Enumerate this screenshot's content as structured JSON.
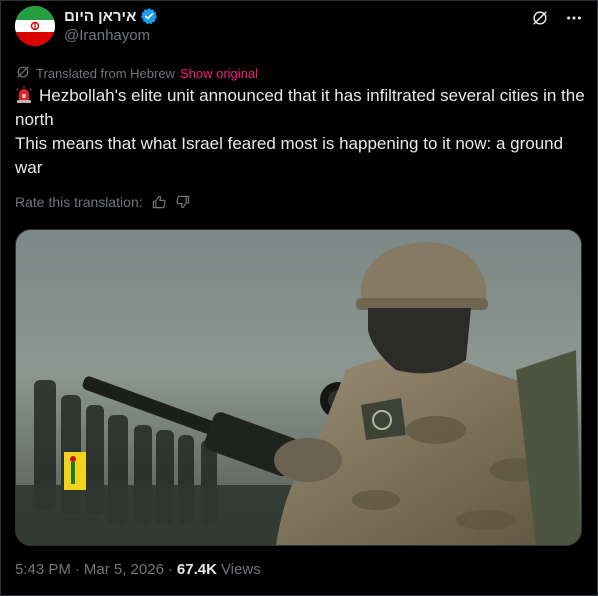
{
  "author": {
    "display_name": "איראן היום",
    "handle": "@Iranhayom"
  },
  "translation": {
    "note": "Translated from Hebrew",
    "show_original": "Show original",
    "rate_label": "Rate this translation:"
  },
  "tweet": {
    "line1": "Hezbollah's elite unit announced that it has infiltrated several cities in the north",
    "line2": "This means that what Israel feared most is happening to it now: a ground war"
  },
  "meta": {
    "time": "5:43 PM",
    "separator": "·",
    "date": "Mar 5, 2026",
    "views_count": "67.4K",
    "views_label": "Views"
  },
  "colors": {
    "background": "#000000",
    "text": "#e7e9ea",
    "muted": "#71767b",
    "link": "#f91880",
    "verified": "#1d9bf0"
  },
  "icons": [
    "verified-badge-icon",
    "grok-icon",
    "more-icon",
    "translate-icon",
    "siren-emoji-icon",
    "thumbs-up-icon",
    "thumbs-down-icon"
  ]
}
